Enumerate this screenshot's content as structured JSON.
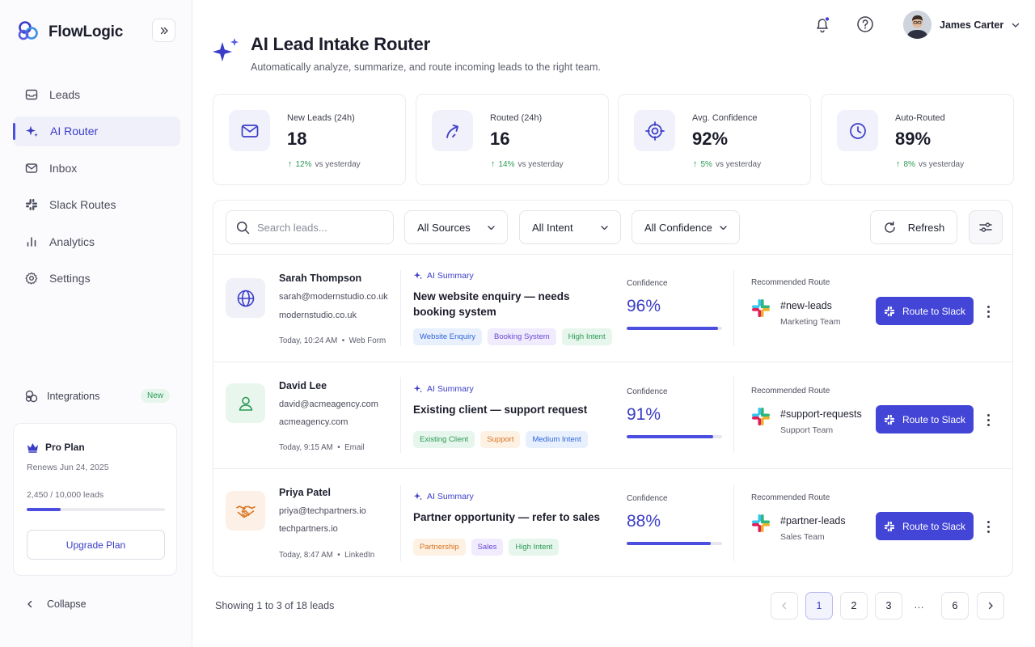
{
  "app": {
    "name": "FlowLogic"
  },
  "nav": [
    {
      "label": "Leads",
      "icon": "mail-icon",
      "active": false
    },
    {
      "label": "AI Router",
      "icon": "sparkle-icon",
      "active": true
    },
    {
      "label": "Inbox",
      "icon": "inbox-icon",
      "active": false
    },
    {
      "label": "Slack Routes",
      "icon": "slack-icon",
      "active": false
    },
    {
      "label": "Analytics",
      "icon": "bar-chart-icon",
      "active": false
    },
    {
      "label": "Settings",
      "icon": "gear-icon",
      "active": false
    }
  ],
  "integrations": {
    "label": "Integrations",
    "badge": "New"
  },
  "plan": {
    "name": "Pro Plan",
    "renews": "Renews Jun 24, 2025",
    "usage": "2,450 / 10,000 leads",
    "usage_fraction": 0.245,
    "upgrade_label": "Upgrade Plan"
  },
  "collapse_label": "Collapse",
  "user": {
    "name": "James Carter"
  },
  "header": {
    "title": "AI Lead Intake Router",
    "subtitle": "Automatically analyze, summarize, and route incoming leads to the right team."
  },
  "stats": [
    {
      "label": "New Leads (24h)",
      "value": "18",
      "delta": "12%",
      "delta_text": "vs yesterday",
      "icon": "mail-icon"
    },
    {
      "label": "Routed (24h)",
      "value": "16",
      "delta": "14%",
      "delta_text": "vs yesterday",
      "icon": "route-arrow-icon"
    },
    {
      "label": "Avg. Confidence",
      "value": "92%",
      "delta": "5%",
      "delta_text": "vs yesterday",
      "icon": "target-icon"
    },
    {
      "label": "Auto-Routed",
      "value": "89%",
      "delta": "8%",
      "delta_text": "vs yesterday",
      "icon": "clock-icon"
    }
  ],
  "filters": {
    "search_placeholder": "Search leads...",
    "sources": "All Sources",
    "intent": "All Intent",
    "confidence": "All Confidence",
    "refresh_label": "Refresh"
  },
  "leads": [
    {
      "name": "Sarah Thompson",
      "email": "sarah@modernstudio.co.uk",
      "domain": "modernstudio.co.uk",
      "time": "Today, 10:24 AM",
      "source": "Web Form",
      "icon": "globe-icon",
      "ai_label": "AI Summary",
      "summary": "New website enquiry — needs booking system",
      "tags": [
        "Website Enquiry",
        "Booking System",
        "High Intent"
      ],
      "confidence_label": "Confidence",
      "confidence": "96%",
      "confidence_value": 0.96,
      "route_label": "Recommended Route",
      "channel": "#new-leads",
      "team": "Marketing Team",
      "button": "Route to Slack"
    },
    {
      "name": "David Lee",
      "email": "david@acmeagency.com",
      "domain": "acmeagency.com",
      "time": "Today, 9:15 AM",
      "source": "Email",
      "icon": "user-icon",
      "ai_label": "AI Summary",
      "summary": "Existing client — support request",
      "tags": [
        "Existing Client",
        "Support",
        "Medium Intent"
      ],
      "confidence_label": "Confidence",
      "confidence": "91%",
      "confidence_value": 0.91,
      "route_label": "Recommended Route",
      "channel": "#support-requests",
      "team": "Support Team",
      "button": "Route to Slack"
    },
    {
      "name": "Priya Patel",
      "email": "priya@techpartners.io",
      "domain": "techpartners.io",
      "time": "Today, 8:47 AM",
      "source": "LinkedIn",
      "icon": "handshake-icon",
      "ai_label": "AI Summary",
      "summary": "Partner opportunity — refer to sales",
      "tags": [
        "Partnership",
        "Sales",
        "High Intent"
      ],
      "confidence_label": "Confidence",
      "confidence": "88%",
      "confidence_value": 0.88,
      "route_label": "Recommended Route",
      "channel": "#partner-leads",
      "team": "Sales Team",
      "button": "Route to Slack"
    }
  ],
  "pagination": {
    "showing": "Showing 1 to 3 of 18 leads",
    "pages": [
      "1",
      "2",
      "3",
      "6"
    ],
    "ellipsis": "…",
    "current": "1"
  },
  "colors": {
    "accent": "#4345d6",
    "positive": "#2b9a55",
    "tag_blue_bg": "#e8f0fd",
    "tag_blue_fg": "#2f64d8",
    "tag_purple_bg": "#f0ebfd",
    "tag_purple_fg": "#6a47d6",
    "tag_green_bg": "#e7f6ec",
    "tag_green_fg": "#2b9a55",
    "tag_orange_bg": "#fdf1e4",
    "tag_orange_fg": "#d9731c"
  }
}
